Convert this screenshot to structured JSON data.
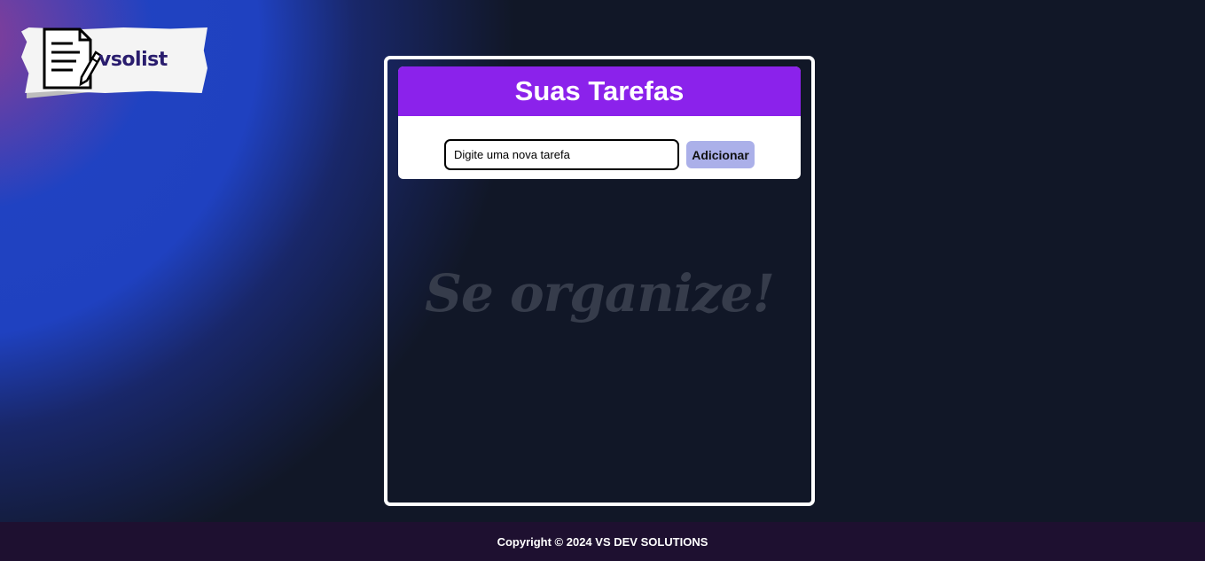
{
  "logo": {
    "brand_text": "vsolist",
    "icon": "document-pencil-icon"
  },
  "todo": {
    "title": "Suas Tarefas",
    "input": {
      "value": "",
      "placeholder": "Digite uma nova tarefa"
    },
    "add_button_label": "Adicionar",
    "empty_message": "Se organize!"
  },
  "footer": {
    "copyright": "Copyright © 2024 VS DEV SOLUTIONS"
  },
  "colors": {
    "background": "#111727",
    "accent_gradient_blue": "#1f41c0",
    "header_purple": "#8b22eb",
    "button_lavender": "#abb0e9",
    "footer_bg": "#1e1030",
    "empty_text": "#363c4b"
  }
}
